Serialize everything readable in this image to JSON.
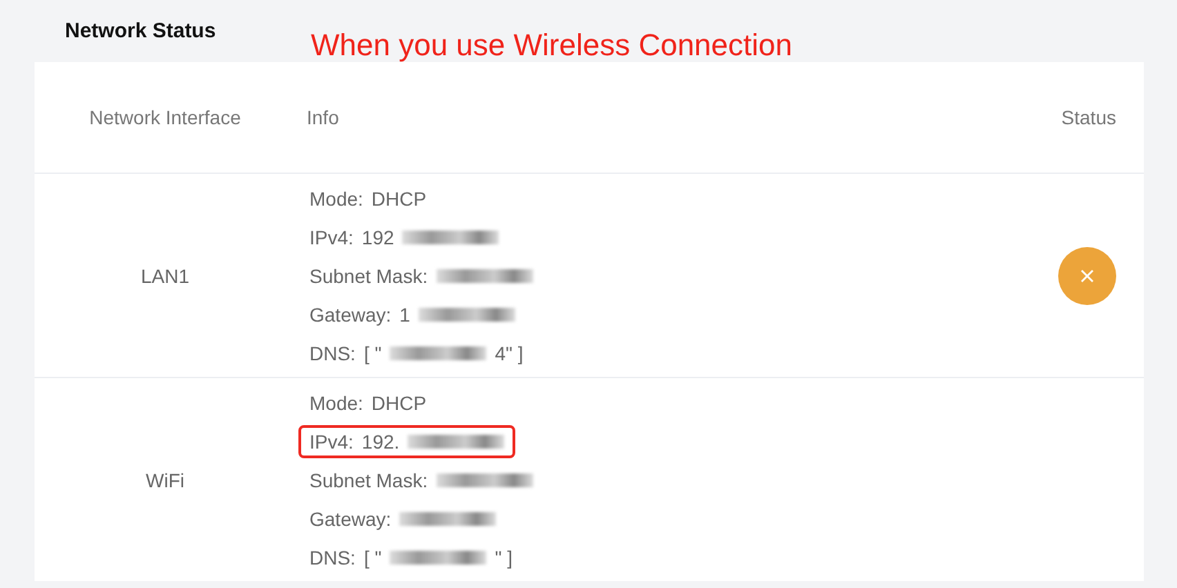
{
  "title": "Network Status",
  "annotation": "When you use Wireless Connection",
  "table": {
    "columns": [
      "Network Interface",
      "Info",
      "Status"
    ],
    "rows": [
      {
        "interface": "LAN1",
        "error": true,
        "lines": [
          {
            "label": "Mode:",
            "before": "DHCP",
            "redacted": false,
            "highlighted": false
          },
          {
            "label": "IPv4:",
            "before": "192",
            "redacted": true,
            "highlighted": false
          },
          {
            "label": "Subnet Mask:",
            "redacted": true,
            "highlighted": false
          },
          {
            "label": "Gateway:",
            "before": "1",
            "redacted": true,
            "highlighted": false
          },
          {
            "label": "DNS:",
            "before": "[ \"",
            "redacted": true,
            "after": "4\" ]",
            "highlighted": false
          }
        ]
      },
      {
        "interface": "WiFi",
        "lines": [
          {
            "label": "Mode:",
            "before": "DHCP",
            "redacted": false,
            "highlighted": false
          },
          {
            "label": "IPv4:",
            "before": "192.",
            "redacted": true,
            "highlighted": true
          },
          {
            "label": "Subnet Mask:",
            "redacted": true,
            "highlighted": false
          },
          {
            "label": "Gateway:",
            "redacted": true,
            "highlighted": false
          },
          {
            "label": "DNS:",
            "before": "[ \"",
            "redacted": true,
            "after": "\" ]",
            "highlighted": false
          }
        ]
      }
    ]
  }
}
